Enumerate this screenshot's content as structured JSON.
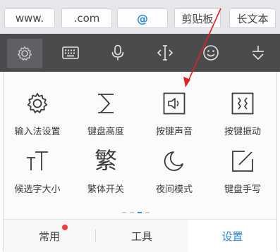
{
  "quickbar": {
    "chips": [
      "www.",
      ".com",
      "@",
      "剪贴板",
      "长文本"
    ]
  },
  "toolbar": {
    "icons": [
      "settings-icon",
      "keyboard-icon",
      "microphone-icon",
      "cursor-move-icon",
      "emoji-icon",
      "collapse-icon"
    ],
    "active_index": 0
  },
  "settings_grid": [
    {
      "label": "输入法设置",
      "icon": "settings-icon"
    },
    {
      "label": "键盘高度",
      "icon": "keyboard-height-icon"
    },
    {
      "label": "按键声音",
      "icon": "key-sound-icon"
    },
    {
      "label": "按键振动",
      "icon": "key-vibration-icon"
    },
    {
      "label": "候选字大小",
      "icon": "candidate-size-icon"
    },
    {
      "label": "繁体开关",
      "icon": "traditional-chinese-icon",
      "glyph": "繁"
    },
    {
      "label": "夜间模式",
      "icon": "night-mode-icon"
    },
    {
      "label": "键盘手写",
      "icon": "handwriting-icon"
    }
  ],
  "pager": {
    "pages": 4,
    "current": 3
  },
  "tabs": [
    {
      "label": "常用",
      "badge": true
    },
    {
      "label": "工具",
      "badge": false
    },
    {
      "label": "设置",
      "badge": false,
      "selected": true
    }
  ],
  "colors": {
    "accent": "#2f86d6",
    "badge": "#f23b3b",
    "arrow": "#e02020"
  }
}
